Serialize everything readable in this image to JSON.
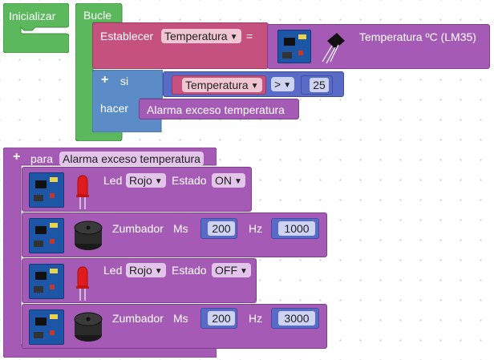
{
  "colors": {
    "init_green": "#5cb85c",
    "loop_green": "#5cb85c",
    "set_red": "#c5517e",
    "sensor_purple": "#a55bb5",
    "if_blue": "#5b8cc7",
    "compare_blue": "#5a6ac7",
    "proc_purple": "#a55bb5"
  },
  "blocks": {
    "inicializar": {
      "label": "Inicializar"
    },
    "bucle": {
      "label": "Bucle"
    },
    "establecer": {
      "label": "Establecer",
      "variable": "Temperatura",
      "equals": "=",
      "sensor_label": "Temperatura ºC (LM35)"
    },
    "si": {
      "label": "si",
      "variable": "Temperatura",
      "operator": ">",
      "value": "25",
      "do_label": "hacer",
      "call": "Alarma exceso temperatura"
    },
    "procedure": {
      "label": "para",
      "name": "Alarma exceso temperatura",
      "steps": [
        {
          "type": "led",
          "label": "Led",
          "color": "Rojo",
          "state_label": "Estado",
          "state": "ON"
        },
        {
          "type": "buzzer",
          "label": "Zumbador",
          "ms_label": "Ms",
          "ms": "200",
          "hz_label": "Hz",
          "hz": "1000"
        },
        {
          "type": "led",
          "label": "Led",
          "color": "Rojo",
          "state_label": "Estado",
          "state": "OFF"
        },
        {
          "type": "buzzer",
          "label": "Zumbador",
          "ms_label": "Ms",
          "ms": "200",
          "hz_label": "Hz",
          "hz": "3000"
        }
      ]
    }
  }
}
